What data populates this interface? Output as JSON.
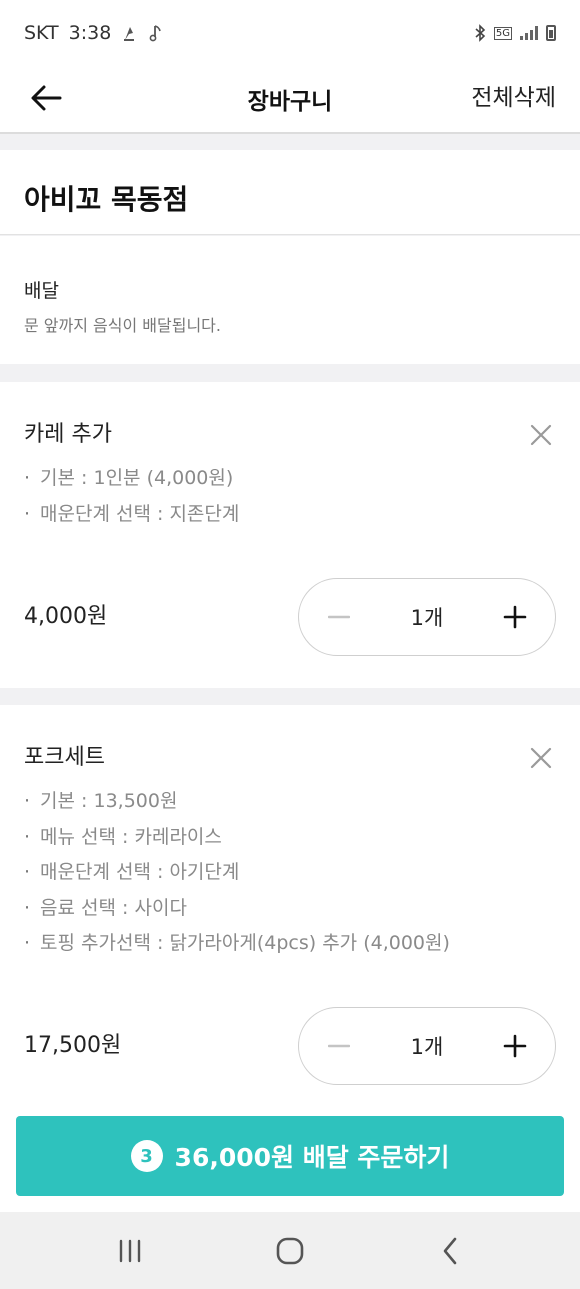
{
  "status_bar": {
    "carrier": "SKT",
    "time": "3:38",
    "network_tag": "5G"
  },
  "header": {
    "title": "장바구니",
    "clear_all_label": "전체삭제"
  },
  "store": {
    "name": "아비꼬 목동점"
  },
  "delivery": {
    "label": "배달",
    "description": "문 앞까지 음식이 배달됩니다."
  },
  "cart_items": [
    {
      "name": "카레 추가",
      "options": [
        "기본 : 1인분 (4,000원)",
        "매운단계 선택 : 지존단계"
      ],
      "price": "4,000원",
      "quantity": "1개"
    },
    {
      "name": "포크세트",
      "options": [
        "기본 : 13,500원",
        "메뉴 선택 : 카레라이스",
        "매운단계 선택 : 아기단계",
        "음료 선택 : 사이다",
        "토핑 추가선택 : 닭가라아게(4pcs) 추가 (4,000원)"
      ],
      "price": "17,500원",
      "quantity": "1개"
    }
  ],
  "order_button": {
    "count": "3",
    "label": "36,000원 배달 주문하기"
  },
  "colors": {
    "accent": "#2ec2bd",
    "background": "#f1f1f3",
    "muted_text": "#8a8a8a"
  }
}
